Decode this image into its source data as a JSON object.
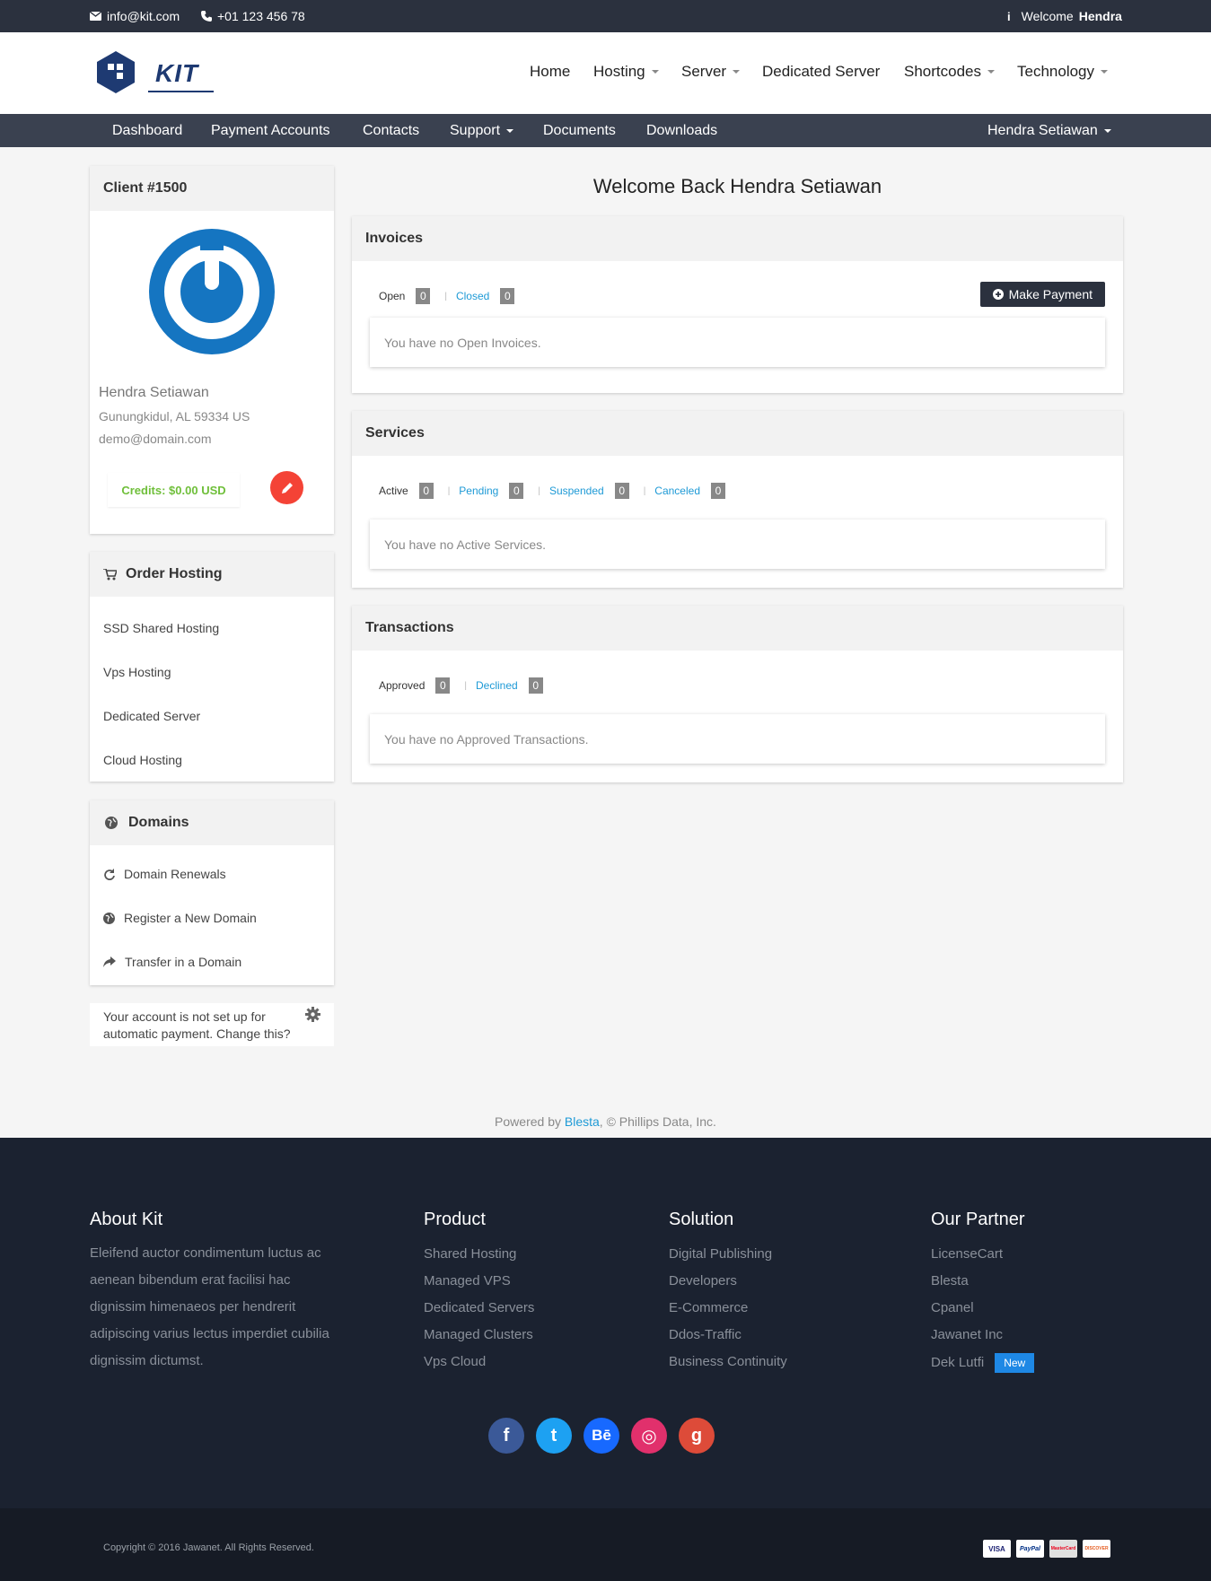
{
  "topbar": {
    "email": "info@kit.com",
    "phone": "+01 123 456 78",
    "welcome_prefix": "Welcome",
    "welcome_name": "Hendra"
  },
  "logo": {
    "text": "KIT"
  },
  "mainnav": {
    "items": [
      {
        "label": "Home",
        "dropdown": false
      },
      {
        "label": "Hosting",
        "dropdown": true
      },
      {
        "label": "Server",
        "dropdown": true
      },
      {
        "label": "Dedicated Server",
        "dropdown": false
      },
      {
        "label": "Shortcodes",
        "dropdown": true
      },
      {
        "label": "Technology",
        "dropdown": true
      }
    ]
  },
  "subnav": {
    "items": [
      "Dashboard",
      "Payment Accounts",
      "Contacts",
      "Support",
      "Documents",
      "Downloads"
    ],
    "user": "Hendra Setiawan"
  },
  "client": {
    "title": "Client #1500",
    "name": "Hendra Setiawan",
    "address": "Gunungkidul, AL 59334 US",
    "email": "demo@domain.com",
    "credits": "Credits: $0.00 USD"
  },
  "order_hosting": {
    "title": "Order Hosting",
    "items": [
      "SSD Shared Hosting",
      "Vps Hosting",
      "Dedicated Server",
      "Cloud Hosting"
    ]
  },
  "domains": {
    "title": "Domains",
    "items": [
      "Domain Renewals",
      "Register a New Domain",
      "Transfer in a Domain"
    ]
  },
  "autopay_notice": "Your account is not set up for automatic payment. Change this?",
  "main": {
    "welcome": "Welcome Back Hendra Setiawan",
    "invoices": {
      "title": "Invoices",
      "tabs": [
        {
          "label": "Open",
          "count": "0"
        },
        {
          "label": "Closed",
          "count": "0"
        }
      ],
      "button": "Make Payment",
      "empty": "You have no Open Invoices."
    },
    "services": {
      "title": "Services",
      "tabs": [
        {
          "label": "Active",
          "count": "0"
        },
        {
          "label": "Pending",
          "count": "0"
        },
        {
          "label": "Suspended",
          "count": "0"
        },
        {
          "label": "Canceled",
          "count": "0"
        }
      ],
      "empty": "You have no Active Services."
    },
    "transactions": {
      "title": "Transactions",
      "tabs": [
        {
          "label": "Approved",
          "count": "0"
        },
        {
          "label": "Declined",
          "count": "0"
        }
      ],
      "empty": "You have no Approved Transactions."
    }
  },
  "powered": {
    "prefix": "Powered by",
    "link": "Blesta",
    "suffix": ", © Phillips Data, Inc."
  },
  "footer": {
    "about": {
      "title": "About Kit",
      "text": "Eleifend auctor condimentum luctus ac aenean bibendum erat facilisi hac dignissim himenaeos per hendrerit adipiscing varius lectus imperdiet cubilia dignissim dictumst."
    },
    "product": {
      "title": "Product",
      "items": [
        "Shared Hosting",
        "Managed VPS",
        "Dedicated Servers",
        "Managed Clusters",
        "Vps Cloud"
      ]
    },
    "solution": {
      "title": "Solution",
      "items": [
        "Digital Publishing",
        "Developers",
        "E-Commerce",
        "Ddos-Traffic",
        "Business Continuity"
      ]
    },
    "partner": {
      "title": "Our Partner",
      "items": [
        "LicenseCart",
        "Blesta",
        "Cpanel",
        "Jawanet Inc",
        "Dek Lutfi"
      ],
      "badge": "New"
    },
    "social": [
      {
        "name": "facebook-icon",
        "glyph": "f",
        "color": "#3b5998"
      },
      {
        "name": "twitter-icon",
        "glyph": "t",
        "color": "#1da1f2"
      },
      {
        "name": "behance-icon",
        "glyph": "Bē",
        "color": "#1769ff"
      },
      {
        "name": "instagram-icon",
        "glyph": "◎",
        "color": "#e1306c"
      },
      {
        "name": "google-plus-icon",
        "glyph": "g",
        "color": "#dd4b39"
      }
    ],
    "copyright": "Copyright © 2016 Jawanet. All Rights Reserved.",
    "cards": [
      "VISA",
      "PayPal",
      "MasterCard",
      "DISCOVER"
    ]
  },
  "colors": {
    "topbar": "#2b313e",
    "subnav": "#3a4150",
    "link": "#1e9ad6",
    "credits": "#6fbf3a",
    "edit_button": "#f44336",
    "footer": "#1b2230"
  }
}
